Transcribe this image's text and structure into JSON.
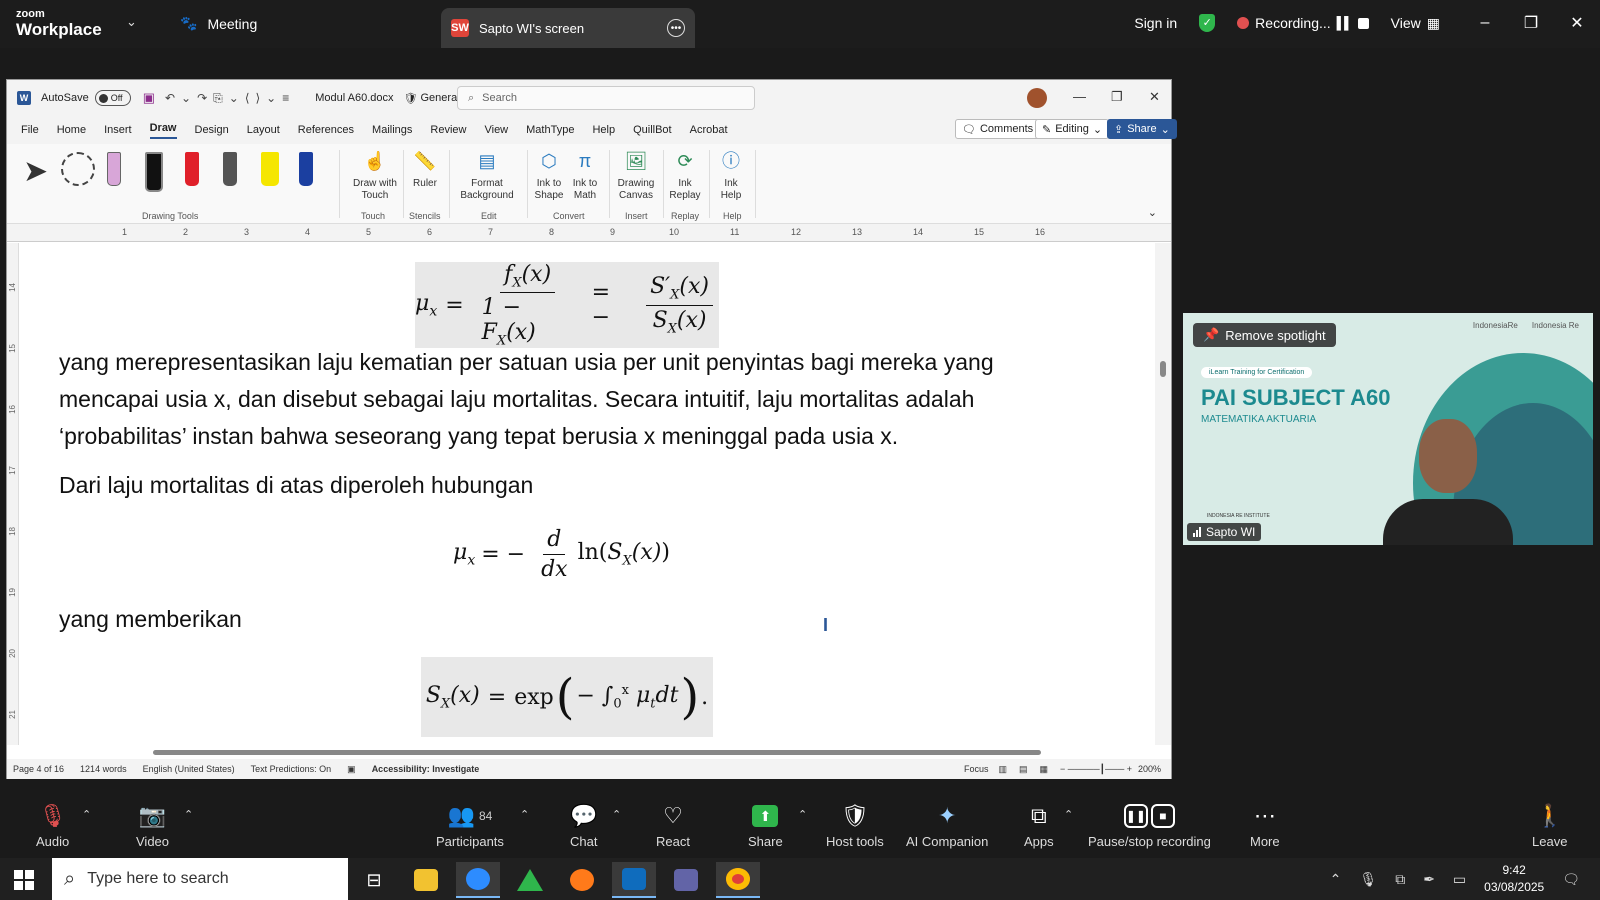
{
  "zoom": {
    "logo_small": "zoom",
    "logo_big": "Workplace",
    "meeting_label": "Meeting",
    "tab_badge": "SW",
    "tab_title": "Sapto WI's screen",
    "sign_in": "Sign in",
    "recording": "Recording...",
    "view": "View"
  },
  "word": {
    "autosave": "AutoSave",
    "autosave_state": "Off",
    "doc_name": "Modul A60.docx",
    "sensitivity": "General",
    "search_placeholder": "Search",
    "menu": [
      "File",
      "Home",
      "Insert",
      "Draw",
      "Design",
      "Layout",
      "References",
      "Mailings",
      "Review",
      "View",
      "MathType",
      "Help",
      "QuillBot",
      "Acrobat"
    ],
    "comments": "Comments",
    "editing": "Editing",
    "share": "Share",
    "ribbon": {
      "drawing_tools": "Drawing Tools",
      "draw_with_touch": "Draw with Touch",
      "touch": "Touch",
      "ruler": "Ruler",
      "stencils": "Stencils",
      "format_background": "Format Background",
      "edit": "Edit",
      "ink_to_shape": "Ink to Shape",
      "ink_to_math": "Ink to Math",
      "convert": "Convert",
      "drawing_canvas": "Drawing Canvas",
      "insert": "Insert",
      "ink_replay": "Ink Replay",
      "replay": "Replay",
      "ink_help": "Ink Help",
      "help": "Help"
    },
    "ruler_ticks": [
      "1",
      "2",
      "3",
      "4",
      "5",
      "6",
      "7",
      "8",
      "9",
      "10",
      "11",
      "12",
      "13",
      "14",
      "15",
      "16"
    ],
    "vruler_ticks": [
      "14",
      "15",
      "16",
      "17",
      "18",
      "19",
      "20",
      "21"
    ],
    "document": {
      "para1": "yang merepresentasikan laju kematian per satuan usia per unit penyintas bagi mereka yang mencapai usia x, dan disebut  sebagai laju mortalitas. Secara intuitif, laju  mortalitas adalah ‘probabilitas’ instan bahwa seseorang yang tepat berusia x meninggal pada usia x.",
      "para2": "Dari laju mortalitas di atas diperoleh hubungan",
      "para3": "yang memberikan"
    },
    "status": {
      "page": "Page 4 of 16",
      "words": "1214 words",
      "language": "English (United States)",
      "predictions": "Text Predictions: On",
      "accessibility": "Accessibility: Investigate",
      "focus": "Focus",
      "zoom": "200%"
    }
  },
  "video": {
    "remove_spotlight": "Remove spotlight",
    "banner": "iLearn Training for Certification",
    "title": "PAI SUBJECT A60",
    "subtitle": "MATEMATIKA AKTUARIA",
    "logo_left": "IndonesiaRe",
    "logo_right": "Indonesia Re",
    "institute": "INDONESIA RE INSTITUTE",
    "name": "Sapto WI"
  },
  "toolbar": {
    "audio": "Audio",
    "video": "Video",
    "participants": "Participants",
    "participants_count": "84",
    "chat": "Chat",
    "react": "React",
    "share": "Share",
    "host_tools": "Host tools",
    "ai_companion": "AI Companion",
    "apps": "Apps",
    "pause_recording": "Pause/stop recording",
    "more": "More",
    "leave": "Leave"
  },
  "taskbar": {
    "search_placeholder": "Type here to search",
    "time": "9:42",
    "date": "03/08/2025"
  },
  "colors": {
    "accent_green": "#2fb64c",
    "word_blue": "#2b5797",
    "zoom_bg": "#1a1a1a",
    "slide_teal": "#1c8a8f"
  }
}
